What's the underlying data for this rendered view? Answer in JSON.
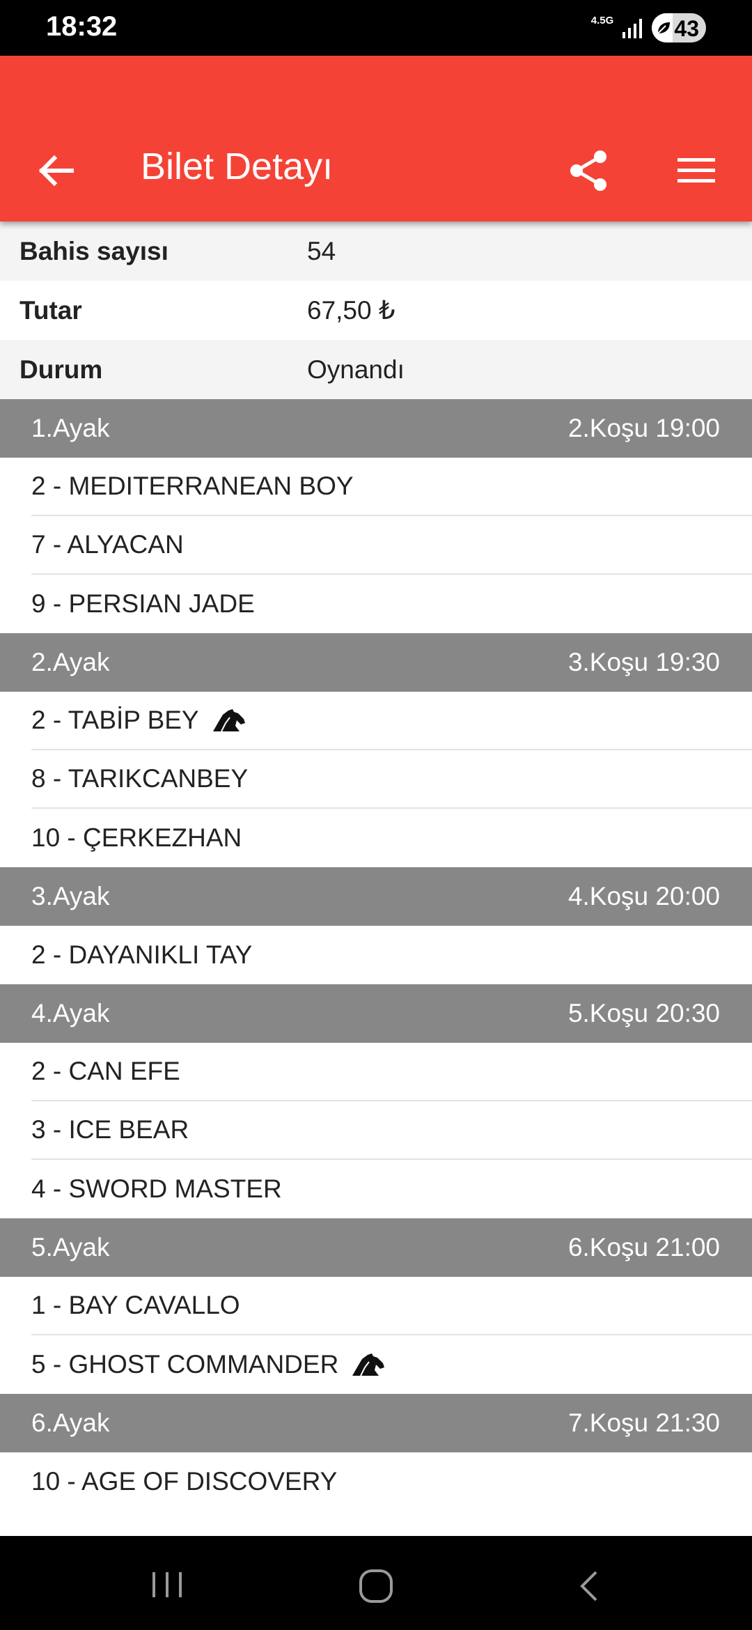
{
  "status_bar": {
    "time": "18:32",
    "network": "4.5G",
    "battery": "43"
  },
  "app_bar": {
    "title": "Bilet Detayı",
    "icons": [
      "back-arrow-icon",
      "share-icon",
      "menu-icon"
    ]
  },
  "info": [
    {
      "label": "Bahis sayısı",
      "value": "54"
    },
    {
      "label": "Tutar",
      "value": "67,50 ₺"
    },
    {
      "label": "Durum",
      "value": "Oynandı"
    }
  ],
  "legs": [
    {
      "leg": "1.Ayak",
      "race": "2.Koşu 19:00",
      "horses": [
        {
          "name": "2 - MEDITERRANEAN BOY",
          "icon": false
        },
        {
          "name": "7 - ALYACAN",
          "icon": false
        },
        {
          "name": "9 - PERSIAN JADE",
          "icon": false
        }
      ]
    },
    {
      "leg": "2.Ayak",
      "race": "3.Koşu 19:30",
      "horses": [
        {
          "name": "2 - TABİP BEY",
          "icon": true
        },
        {
          "name": "8 - TARIKCANBEY",
          "icon": false
        },
        {
          "name": "10 - ÇERKEZHAN",
          "icon": false
        }
      ]
    },
    {
      "leg": "3.Ayak",
      "race": "4.Koşu 20:00",
      "horses": [
        {
          "name": "2 - DAYANIKLI TAY",
          "icon": false
        }
      ]
    },
    {
      "leg": "4.Ayak",
      "race": "5.Koşu 20:30",
      "horses": [
        {
          "name": "2 - CAN EFE",
          "icon": false
        },
        {
          "name": "3 - ICE BEAR",
          "icon": false
        },
        {
          "name": "4 - SWORD MASTER",
          "icon": false
        }
      ]
    },
    {
      "leg": "5.Ayak",
      "race": "6.Koşu 21:00",
      "horses": [
        {
          "name": "1 - BAY CAVALLO",
          "icon": false
        },
        {
          "name": "5 - GHOST COMMANDER",
          "icon": true
        }
      ]
    },
    {
      "leg": "6.Ayak",
      "race": "7.Koşu 21:30",
      "horses": [
        {
          "name": "10 - AGE OF DISCOVERY",
          "icon": false
        }
      ]
    }
  ],
  "colors": {
    "app_bar": "#f44336",
    "leg_header": "#878787",
    "shaded_row": "#f4f4f4"
  },
  "nav_bar": {
    "icons": [
      "recents-icon",
      "home-icon",
      "nav-back-icon"
    ]
  }
}
